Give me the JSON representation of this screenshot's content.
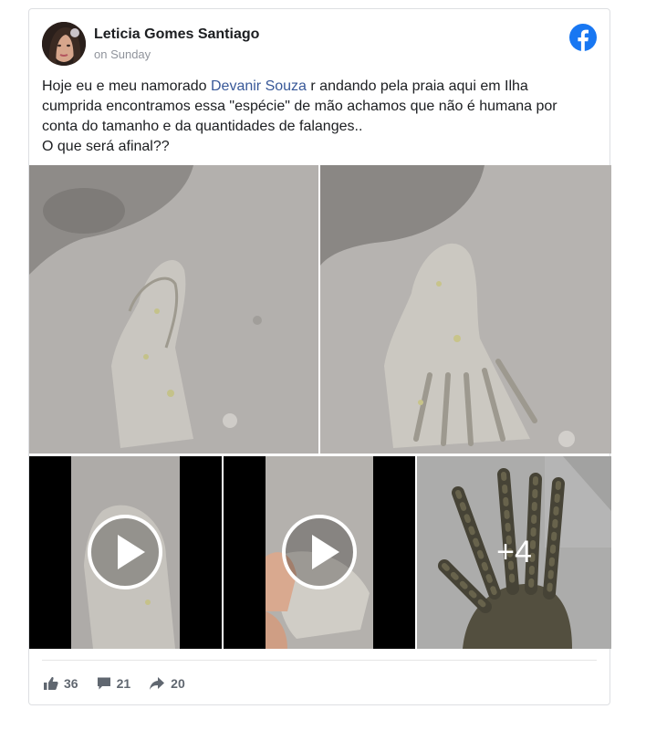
{
  "post": {
    "author": "Leticia Gomes Santiago",
    "timestamp": "on Sunday",
    "text_line1_before": "Hoje eu e meu namorado ",
    "mention": "Devanir Souza",
    "text_line1_after": " r andando pela praia aqui em Ilha",
    "text_line2": "cumprida encontramos essa \"espécie\" de mão achamos que não é humana por",
    "text_line3": "conta do tamanho e da quantidades de falanges..",
    "text_line4": "O que será afinal??"
  },
  "media": {
    "more_count": "+4"
  },
  "reactions": {
    "likes": "36",
    "comments": "21",
    "shares": "20"
  },
  "icons": {
    "brand": "facebook-logo-icon",
    "like": "thumbs-up-icon",
    "comment": "comment-bubble-icon",
    "share": "share-arrow-icon",
    "play": "play-icon"
  },
  "colors": {
    "facebook_blue": "#1877f2",
    "mention_blue": "#385898",
    "meta_gray": "#90949c",
    "stat_gray": "#606770"
  }
}
